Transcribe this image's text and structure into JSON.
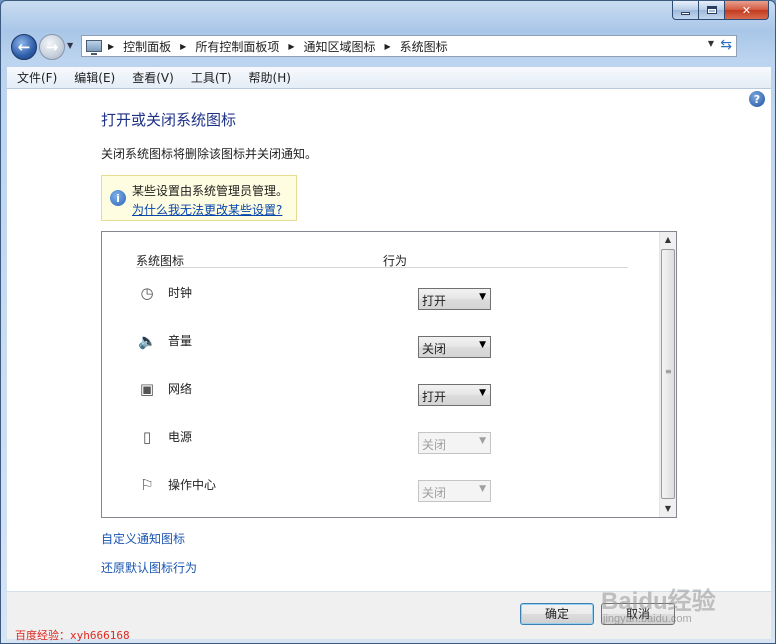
{
  "window": {
    "caption": {
      "minimize": "minimize",
      "maximize": "maximize",
      "close": "✕"
    }
  },
  "nav": {
    "breadcrumbs": [
      "控制面板",
      "所有控制面板项",
      "通知区域图标",
      "系统图标"
    ]
  },
  "menu": {
    "items": [
      "文件(F)",
      "编辑(E)",
      "查看(V)",
      "工具(T)",
      "帮助(H)"
    ]
  },
  "page": {
    "title": "打开或关闭系统图标",
    "description": "关闭系统图标将删除该图标并关闭通知。",
    "notice_text": "某些设置由系统管理员管理。",
    "notice_link": "为什么我无法更改某些设置?"
  },
  "table": {
    "col_icon": "系统图标",
    "col_behavior": "行为",
    "rows": [
      {
        "icon": "clock-icon",
        "label": "时钟",
        "value": "打开",
        "disabled": false
      },
      {
        "icon": "volume-icon",
        "label": "音量",
        "value": "关闭",
        "disabled": false
      },
      {
        "icon": "network-icon",
        "label": "网络",
        "value": "打开",
        "disabled": false
      },
      {
        "icon": "power-icon",
        "label": "电源",
        "value": "关闭",
        "disabled": true
      },
      {
        "icon": "action-center-flag-icon",
        "label": "操作中心",
        "value": "关闭",
        "disabled": true
      }
    ]
  },
  "links": {
    "customize": "自定义通知图标",
    "restore": "还原默认图标行为"
  },
  "footer": {
    "ok": "确定",
    "cancel": "取消"
  },
  "watermarks": {
    "left": "百度经验：xyh666168",
    "logo": "Baidu经验",
    "url": "jingyan.baidu.com"
  }
}
